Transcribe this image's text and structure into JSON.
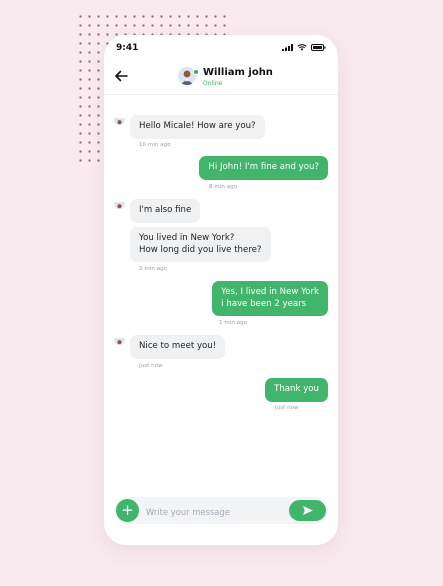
{
  "status_bar": {
    "time": "9:41"
  },
  "header": {
    "name": "William john",
    "status": "Online"
  },
  "messages": [
    {
      "lines": [
        "Hello Micale! How are you?"
      ],
      "time": "10 min ago"
    },
    {
      "lines": [
        "Hi John! I'm fine and you?"
      ],
      "time": "8 min ago"
    },
    {
      "lines": [
        "I'm also fine"
      ]
    },
    {
      "lines": [
        "You lived in New York?",
        "How long did you live there?"
      ],
      "time": "2 min ago"
    },
    {
      "lines": [
        "Yes, I lived in New York",
        "i have been 2 years"
      ],
      "time": "1 min ago"
    },
    {
      "lines": [
        "Nice to meet you!"
      ],
      "time": "Just now"
    },
    {
      "lines": [
        "Thank you"
      ],
      "time": "Just now"
    }
  ],
  "composer": {
    "placeholder": "Write your message"
  },
  "colors": {
    "accent": "#40b56b",
    "background": "#f8eaef",
    "incoming_bubble": "#eff1f3"
  },
  "icons": [
    "back-arrow-icon",
    "signal-icon",
    "wifi-icon",
    "battery-icon",
    "plus-icon",
    "send-icon"
  ]
}
